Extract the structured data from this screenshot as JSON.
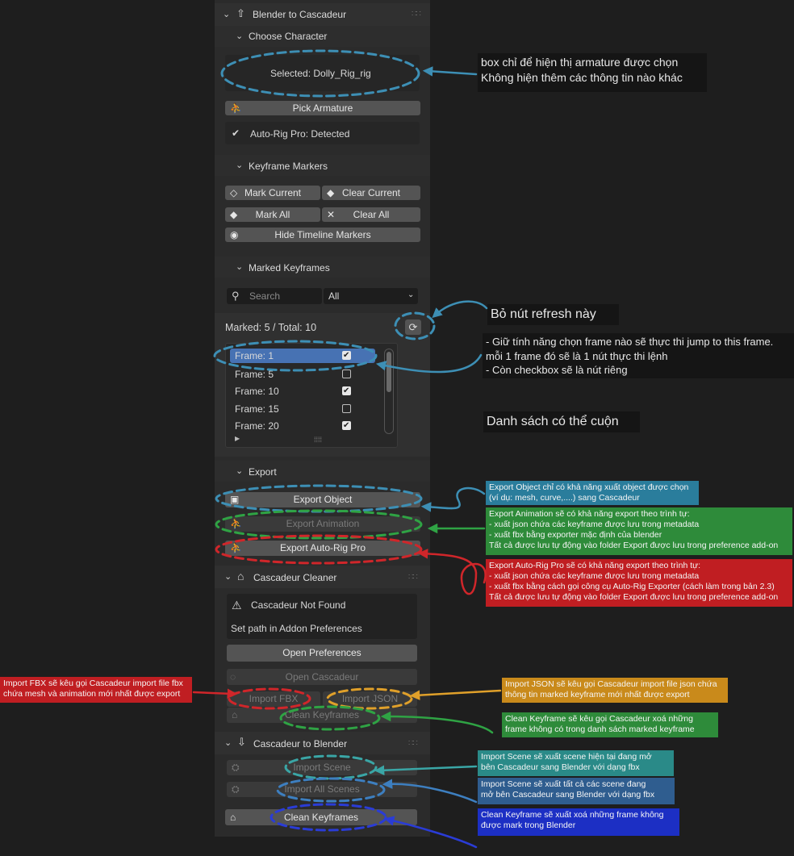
{
  "blender_to_cascadeur": {
    "title": "Blender to Cascadeur",
    "choose_character": "Choose Character",
    "selected": "Selected: Dolly_Rig_rig",
    "pick_armature": "Pick Armature",
    "autorig_detected": "Auto-Rig Pro: Detected"
  },
  "keyframe_markers": {
    "title": "Keyframe Markers",
    "mark_current": "Mark Current",
    "clear_current": "Clear Current",
    "mark_all": "Mark All",
    "clear_all": "Clear All",
    "hide_timeline_markers": "Hide Timeline Markers"
  },
  "marked_keyframes": {
    "title": "Marked Keyframes",
    "search_placeholder": "Search",
    "filter_value": "All",
    "summary": "Marked: 5 / Total: 10",
    "frames": [
      {
        "label": "Frame: 1",
        "checked": true,
        "selected": true
      },
      {
        "label": "Frame: 5",
        "checked": false,
        "selected": false
      },
      {
        "label": "Frame: 10",
        "checked": true,
        "selected": false
      },
      {
        "label": "Frame: 15",
        "checked": false,
        "selected": false
      },
      {
        "label": "Frame: 20",
        "checked": true,
        "selected": false
      }
    ]
  },
  "export": {
    "title": "Export",
    "export_object": "Export Object",
    "export_animation": "Export Animation",
    "export_autorig": "Export Auto-Rig Pro"
  },
  "cleaner": {
    "title": "Cascadeur Cleaner",
    "not_found": "Cascadeur Not Found",
    "set_path": "Set path in Addon Preferences",
    "open_preferences": "Open Preferences",
    "open_cascadeur": "Open Cascadeur",
    "import_fbx": "Import FBX",
    "import_json": "Import JSON",
    "clean_keyframes": "Clean Keyframes"
  },
  "cascadeur_to_blender": {
    "title": "Cascadeur to Blender",
    "import_scene": "Import Scene",
    "import_all_scenes": "Import All Scenes",
    "clean_keyframes": "Clean Keyframes"
  },
  "notes": {
    "box_selected": [
      "box chỉ để hiện thị armature được chọn",
      "Không hiện thêm các thông tin nào khác"
    ],
    "refresh": "Bỏ nút refresh này",
    "frame_behavior": [
      "- Giữ tính năng chọn frame nào sẽ thực thi jump to this frame.",
      "mỗi 1 frame đó sẽ là 1 nút thực thi lệnh",
      "- Còn checkbox sẽ là nút riêng"
    ],
    "scrollable": "Danh sách có thể cuộn",
    "export_object": [
      "Export Object chỉ có khả năng xuất object được chọn",
      "(ví dụ: mesh, curve,....) sang Cascadeur"
    ],
    "export_animation": [
      "Export Animation sẽ có khả năng export theo trình tự:",
      "- xuất json chứa các keyframe được lưu trong metadata",
      "- xuất fbx bằng exporter mặc định của blender",
      "Tất cả được lưu tự động vào folder Export được lưu trong preference add-on"
    ],
    "export_autorig": [
      "Export Auto-Rig Pro sẽ có khả năng export theo trình tự:",
      "- xuất json chứa các keyframe được lưu trong metadata",
      "- xuất fbx bằng cách gọi công cụ Auto-Rig Exporter (cách làm trong bản 2.3)",
      "Tất cả được lưu tự động vào folder Export được lưu trong preference add-on"
    ],
    "import_fbx": [
      "Import FBX sẽ kêu gọi Cascadeur import file fbx",
      "chứa mesh và animation mới nhất được export"
    ],
    "import_json": [
      "Import JSON sẽ kêu gọi Cascadeur import file json chứa",
      "thông tin marked keyframe mới nhất được export"
    ],
    "clean_keyframe": [
      "Clean Keyframe sẽ kêu gọi Cascadeur xoá những",
      "frame không có trong danh sách marked keyframe"
    ],
    "import_scene": [
      "Import Scene sẽ xuất scene hiện tại đang mở",
      "bên Cascadeur sang Blender với dạng fbx"
    ],
    "import_all_scenes": [
      "Import Scene sẽ xuất tất cả các scene đang",
      "mở bên Cascadeur sang Blender với dạng fbx"
    ],
    "clean_blender": [
      "Clean Keyframe sẽ xuất xoá những frame không",
      "được mark trong  Blender"
    ]
  },
  "colors": {
    "panel": "#2b2b2b",
    "header": "#303030",
    "button": "#545454",
    "selected_row": "#4772b3",
    "note_blue": "#2a7d9c",
    "note_green": "#2e8b3a",
    "note_red": "#c01e22",
    "note_orange": "#c98a1b",
    "note_teal": "#2a8a88",
    "note_navy": "#2f5d8f",
    "note_royal": "#1c2fc4"
  }
}
